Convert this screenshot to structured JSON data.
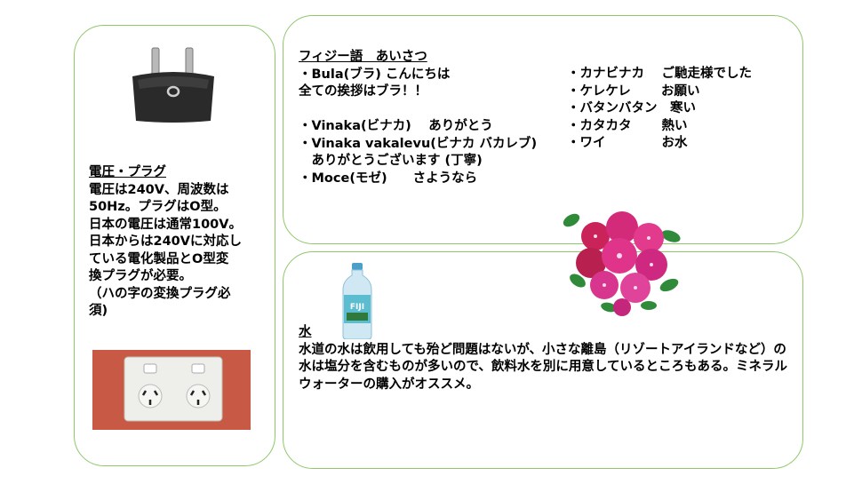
{
  "plug": {
    "heading": "電圧・プラグ",
    "lines": [
      "電圧は240V、周波数は",
      "50Hz。プラグはO型。",
      "日本の電圧は通常100V。",
      "日本からは240Vに対応し",
      "ている電化製品とO型変",
      "換プラグが必要。",
      "（ハの字の変換プラグ必",
      "須)"
    ]
  },
  "fijian": {
    "heading": "フィジー語　あいさつ",
    "left_lines": [
      "・Bula(ブラ) こんにちは",
      "全ての挨拶はブラ！！",
      "",
      "・Vinaka(ビナカ)　 ありがとう",
      "・Vinaka vakalevu(ビナカ バカレブ)",
      "　ありがとうございます (丁寧)",
      "・Moce(モゼ)　　さようなら"
    ],
    "right_lines": [
      "・カナビナカ　 ご馳走様でした",
      "・ケレケレ　　 お願い",
      "・バタンバタン　寒い",
      "・カタカタ　　 熱い",
      "・ワイ　　　　 お水"
    ]
  },
  "water": {
    "heading": "水",
    "body": "水道の水は飲用しても殆ど問題はないが、小さな離島（リゾートアイランドなど）の水は塩分を含むものが多いので、飲料水を別に用意しているところもある。ミネラルウォーターの購入がオススメ。",
    "bottle_label": "FIJI"
  }
}
